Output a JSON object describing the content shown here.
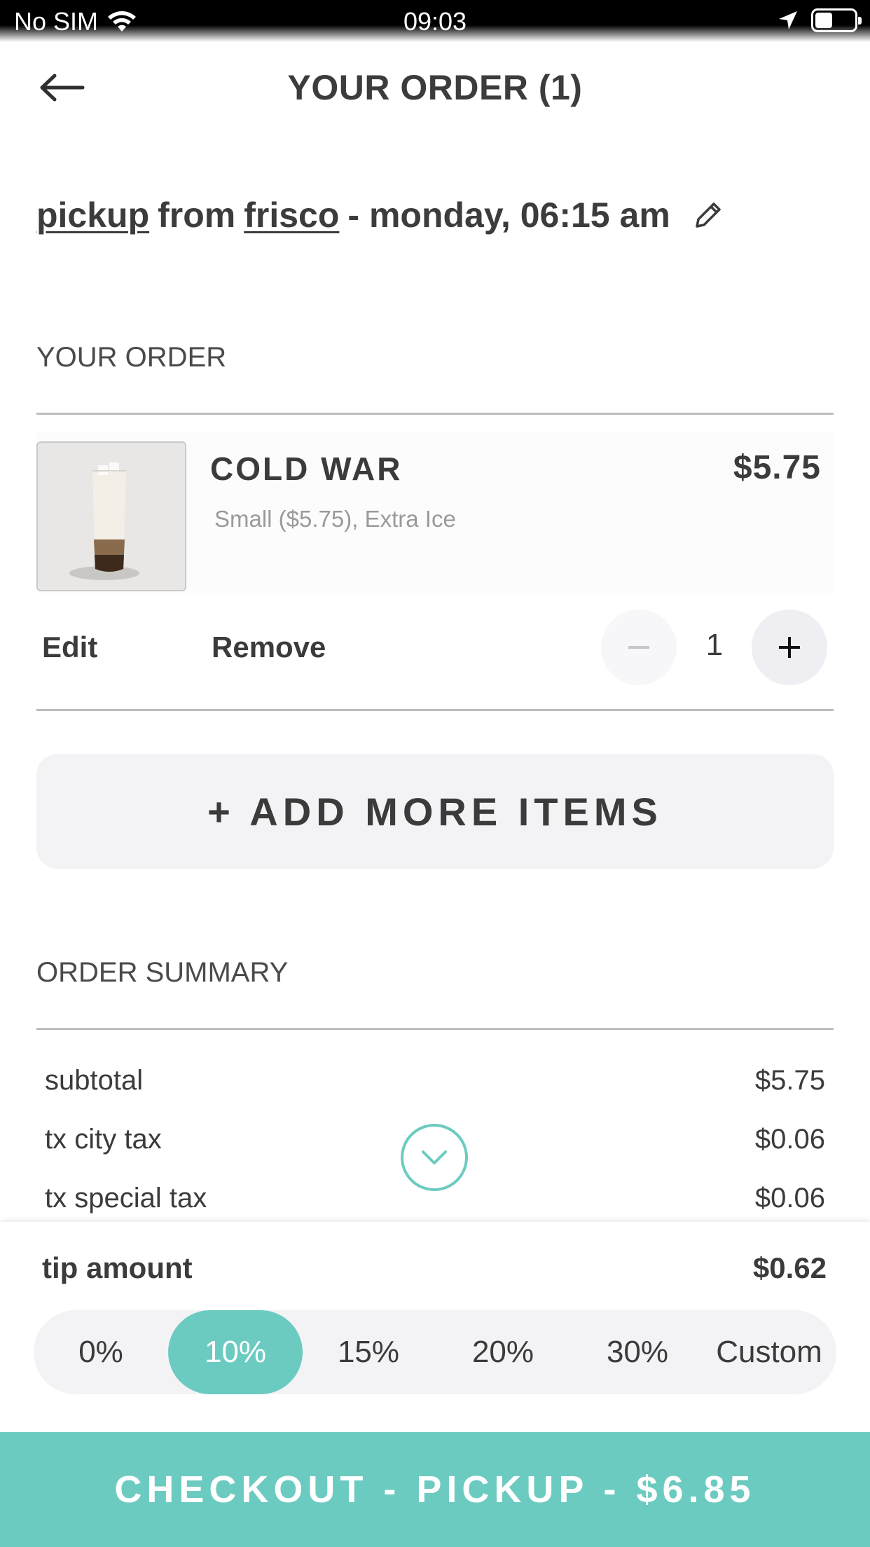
{
  "status_bar": {
    "carrier": "No SIM",
    "time": "09:03"
  },
  "header": {
    "title": "YOUR ORDER (1)"
  },
  "pickup": {
    "mode": "pickup",
    "from": "from",
    "location": "frisco",
    "when": "- monday, 06:15 am"
  },
  "order_section": {
    "title": "YOUR ORDER"
  },
  "item": {
    "name": "COLD WAR",
    "price": "$5.75",
    "modifiers": "Small ($5.75), Extra Ice",
    "edit_label": "Edit",
    "remove_label": "Remove",
    "quantity": "1",
    "minus_label": "−",
    "plus_label": "+"
  },
  "add_more_label": "+ ADD MORE ITEMS",
  "summary": {
    "title": "ORDER SUMMARY",
    "rows": [
      {
        "label": "subtotal",
        "value": "$5.75"
      },
      {
        "label": "tx city tax",
        "value": "$0.06"
      },
      {
        "label": "tx special tax",
        "value": "$0.06"
      }
    ]
  },
  "tip": {
    "label": "tip amount",
    "value": "$0.62",
    "options": [
      "0%",
      "10%",
      "15%",
      "20%",
      "30%",
      "Custom"
    ],
    "selected": "10%"
  },
  "checkout_label": "CHECKOUT - PICKUP - $6.85",
  "colors": {
    "accent": "#6ccbc1",
    "text": "#3b3b3b",
    "panel": "#f3f3f6"
  }
}
